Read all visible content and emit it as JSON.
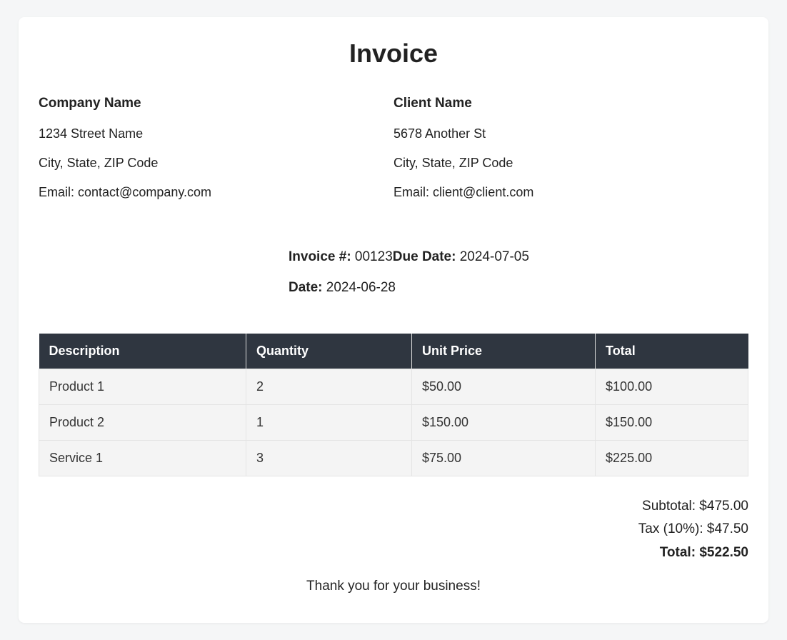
{
  "title": "Invoice",
  "company": {
    "name": "Company Name",
    "street": "1234 Street Name",
    "city": "City, State, ZIP Code",
    "email": "Email: contact@company.com"
  },
  "client": {
    "name": "Client Name",
    "street": "5678 Another St",
    "city": "City, State, ZIP Code",
    "email": "Email: client@client.com"
  },
  "meta": {
    "invoice_label": "Invoice #: ",
    "invoice_value": "00123",
    "due_label": "Due Date: ",
    "due_value": "2024-07-05",
    "date_label": "Date: ",
    "date_value": "2024-06-28"
  },
  "table": {
    "headers": {
      "description": "Description",
      "quantity": "Quantity",
      "unit_price": "Unit Price",
      "total": "Total"
    },
    "rows": [
      {
        "description": "Product 1",
        "quantity": "2",
        "unit_price": "$50.00",
        "total": "$100.00"
      },
      {
        "description": "Product 2",
        "quantity": "1",
        "unit_price": "$150.00",
        "total": "$150.00"
      },
      {
        "description": "Service 1",
        "quantity": "3",
        "unit_price": "$75.00",
        "total": "$225.00"
      }
    ]
  },
  "totals": {
    "subtotal": "Subtotal: $475.00",
    "tax": "Tax (10%): $47.50",
    "grand": "Total: $522.50"
  },
  "footer": "Thank you for your business!"
}
